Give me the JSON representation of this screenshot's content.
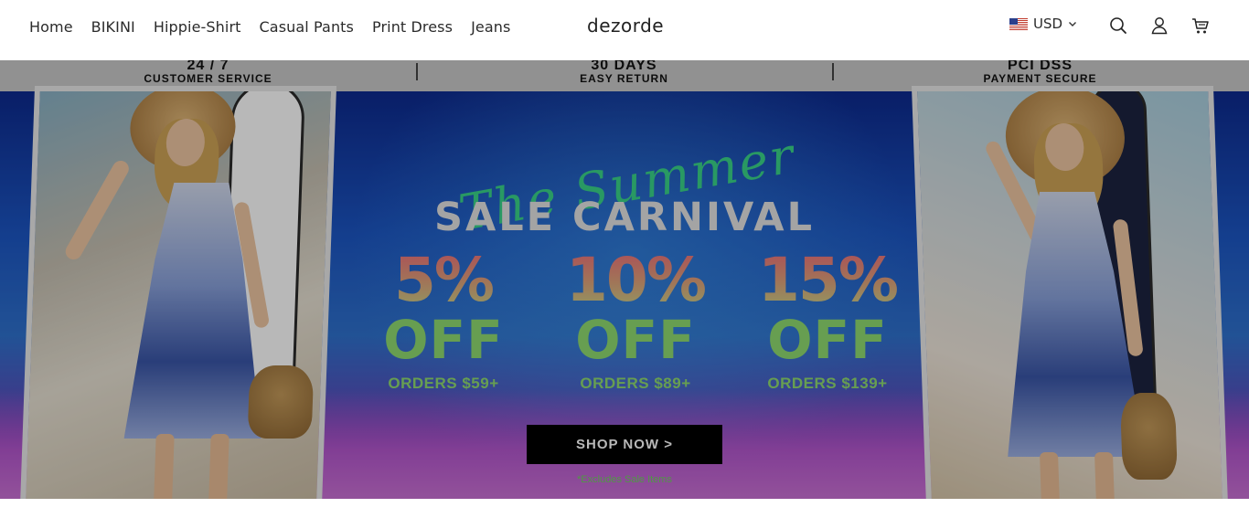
{
  "header": {
    "nav": [
      "Home",
      "BIKINI",
      "Hippie-Shirt",
      "Casual Pants",
      "Print Dress",
      "Jeans"
    ],
    "logo": "dezorde",
    "currency": "USD",
    "icons": [
      "flag-us-icon",
      "chevron-down-icon",
      "search-icon",
      "user-icon",
      "cart-icon"
    ]
  },
  "service_bar": [
    {
      "title": "24 / 7",
      "subtitle": "CUSTOMER SERVICE"
    },
    {
      "title": "30 DAYS",
      "subtitle": "EASY RETURN"
    },
    {
      "title": "PCI DSS",
      "subtitle": "PAYMENT SECURE"
    }
  ],
  "banner": {
    "script_text": "The Summer",
    "headline": "SALE CARNIVAL",
    "offers": [
      {
        "percent": "5%",
        "off": "OFF",
        "orders": "ORDERS $59+"
      },
      {
        "percent": "10%",
        "off": "OFF",
        "orders": "ORDERS $89+"
      },
      {
        "percent": "15%",
        "off": "OFF",
        "orders": "ORDERS $139+"
      }
    ],
    "cta": "SHOP NOW >",
    "disclaimer": "*Excludes Sale Items"
  },
  "colors": {
    "accent_green": "#8fdc71",
    "button_black": "#000000",
    "banner_blue": "#1c56c4"
  }
}
